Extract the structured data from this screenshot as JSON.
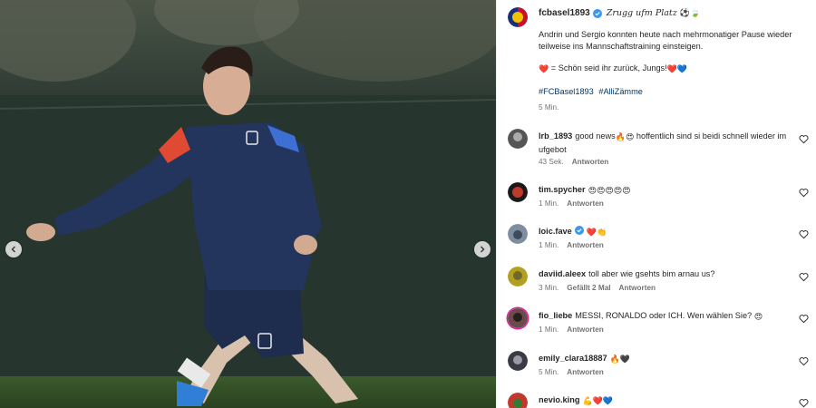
{
  "post": {
    "username": "fcbasel1893",
    "script_title": "Zrugg ufm Platz",
    "title_emoji": "⚽🍃",
    "caption_line": "Andrin und Sergio konnten heute nach mehrmonatiger Pause wieder teilweise ins Mannschaftstraining einsteigen.",
    "caption_emoji_prefix": "❤️",
    "caption_line2": " = Schön seid ihr zurück, Jungs!",
    "caption_emoji_suffix": "❤️💙",
    "hashtags": [
      "#FCBasel1893",
      "#AlliZämme"
    ],
    "time": "5 Min."
  },
  "comments": [
    {
      "username": "lrb_1893",
      "text": "good news",
      "emoji": "🔥😍",
      "text2": " hoffentlich sind si beidi schnell wieder im ufgebot",
      "time": "43 Sek.",
      "likes": "",
      "reply": "Antworten"
    },
    {
      "username": "tim.spycher",
      "text": "",
      "emoji": "😍😍😍😍😍",
      "text2": "",
      "time": "1 Min.",
      "likes": "",
      "reply": "Antworten"
    },
    {
      "username": "loic.fave",
      "text": "",
      "emoji": "❤️👏",
      "text2": "",
      "time": "1 Min.",
      "likes": "",
      "reply": "Antworten",
      "verified": true
    },
    {
      "username": "daviid.aleex",
      "text": "toll aber wie gsehts bim arnau us?",
      "emoji": "",
      "text2": "",
      "time": "3 Min.",
      "likes": "Gefällt 2 Mal",
      "reply": "Antworten"
    },
    {
      "username": "fio_liebe",
      "text": "MESSI, RONALDO oder ICH. Wen wählen Sie?",
      "emoji": "😍",
      "text2": "",
      "time": "1 Min.",
      "likes": "",
      "reply": "Antworten"
    },
    {
      "username": "emily_clara18887",
      "text": "",
      "emoji": "🔥🖤",
      "text2": "",
      "time": "5 Min.",
      "likes": "",
      "reply": "Antworten"
    },
    {
      "username": "nevio.king",
      "text": "",
      "emoji": "💪❤️💙",
      "text2": "",
      "time": "",
      "likes": "",
      "reply": ""
    }
  ],
  "icons": {
    "prev": "chevron-left-icon",
    "next": "chevron-right-icon",
    "like": "heart-outline-icon",
    "verified": "verified-badge-icon"
  },
  "colors": {
    "verified": "#3897f0",
    "hashtag": "#00376b",
    "meta": "#737373"
  }
}
